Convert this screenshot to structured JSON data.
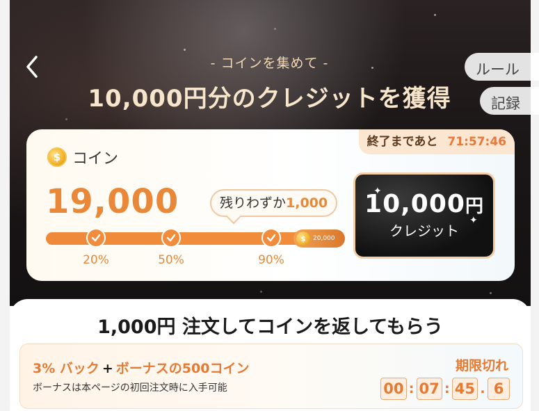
{
  "header": {
    "subtitle": "- コインを集めて -",
    "title": "10,000円分のクレジットを獲得",
    "rules_label": "ルール",
    "records_label": "記録"
  },
  "coin_card": {
    "timer_label": "終了まであと",
    "timer_value": "71:57:46",
    "coin_label": "コイン",
    "coin_amount": "19,000",
    "remaining_label": "残りわずか",
    "remaining_value": "1,000",
    "progress_fraction": 0.95,
    "milestones": [
      {
        "label": "20%"
      },
      {
        "label": "50%"
      },
      {
        "label": "90%"
      }
    ],
    "goal_value": "20,000",
    "reward_amount": "10,000",
    "reward_currency": "円",
    "reward_label": "クレジット"
  },
  "order_section": {
    "title": "1,000円 注文してコインを返してもらう",
    "offer_part1": "3% バック",
    "offer_plus": "+",
    "offer_part2": "ボーナスの500コイン",
    "offer_note": "ボーナスは本ページの初回注文時に入手可能",
    "expired_label": "期限切れ",
    "countdown": {
      "h": "00",
      "m": "07",
      "s": "45",
      "t": "6"
    }
  },
  "colors": {
    "accent": "#e98838",
    "hero_bg": "#1b1617"
  },
  "icons": [
    "back-arrow-icon",
    "coin-icon",
    "check-icon",
    "sparkle-icon"
  ]
}
